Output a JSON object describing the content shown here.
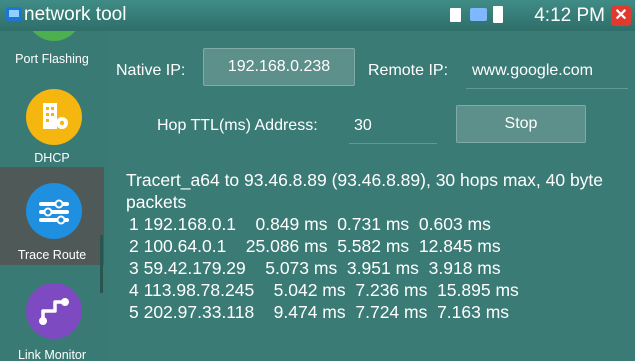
{
  "titlebar": {
    "title": "network tool",
    "time": "4:12 PM"
  },
  "sidebar": {
    "items": [
      {
        "label": "Port Flashing",
        "icon": "port-flashing-icon",
        "color": "#4caf50"
      },
      {
        "label": "DHCP",
        "icon": "dhcp-icon",
        "color": "#f5b70f"
      },
      {
        "label": "Trace Route",
        "icon": "trace-route-icon",
        "color": "#1f8fe0",
        "active": true
      },
      {
        "label": "Link Monitor",
        "icon": "link-monitor-icon",
        "color": "#7d4ac2"
      }
    ]
  },
  "form": {
    "native_ip_label": "Native IP:",
    "native_ip_value": "192.168.0.238",
    "remote_ip_label": "Remote IP:",
    "remote_ip_value": "www.google.com",
    "hop_label": "Hop TTL(ms) Address:",
    "hop_value": "30",
    "stop_label": "Stop"
  },
  "output": {
    "header": "Tracert_a64 to 93.46.8.89 (93.46.8.89), 30 hops max, 40 byte packets",
    "hops": [
      "1 192.168.0.1    0.849 ms  0.731 ms  0.603 ms",
      "2 100.64.0.1    25.086 ms  5.582 ms  12.845 ms",
      "3 59.42.179.29    5.073 ms  3.951 ms  3.918 ms",
      "4 113.98.78.245    5.042 ms  7.236 ms  15.895 ms",
      "5 202.97.33.118    9.474 ms  7.724 ms  7.163 ms"
    ]
  }
}
